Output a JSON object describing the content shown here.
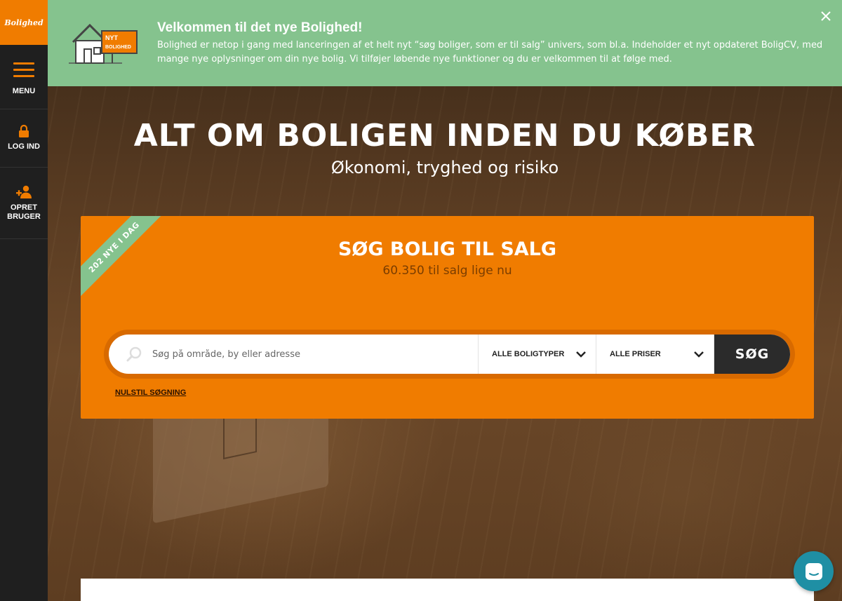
{
  "sidebar": {
    "logo": "Bolighed",
    "menu_label": "MENU",
    "login_label": "LOG IND",
    "create_label_line1": "OPRET",
    "create_label_line2": "BRUGER"
  },
  "banner": {
    "sign_line1": "NYT",
    "sign_line2": "BOLIGHED",
    "title": "Velkommen til det nye Bolighed!",
    "text": "Bolighed er netop i gang med lanceringen af et helt nyt “søg boliger, som er til salg” univers, som bl.a. Indeholder et nyt opdateret BoligCV, med mange nye oplysninger om din nye bolig. Vi tilføjer løbende nye funktioner og du er velkommen til at følge med."
  },
  "hero": {
    "headline": "ALT OM BOLIGEN INDEN DU KØBER",
    "subheadline": "Økonomi, tryghed og risiko"
  },
  "search_card": {
    "ribbon": "202 NYE I DAG",
    "title": "SØG BOLIG TIL SALG",
    "subtitle": "60.350 til salg lige nu",
    "search_placeholder": "Søg på område, by eller adresse",
    "type_dropdown": "ALLE BOLIGTYPER",
    "price_dropdown": "ALLE PRISER",
    "search_button": "SØG",
    "reset_link": "NULSTIL SØGNING"
  },
  "colors": {
    "brand_orange": "#f07c00",
    "banner_green": "#85c38e",
    "sidebar_dark": "#1f1f1f",
    "chat_teal": "#1f8fa4"
  }
}
